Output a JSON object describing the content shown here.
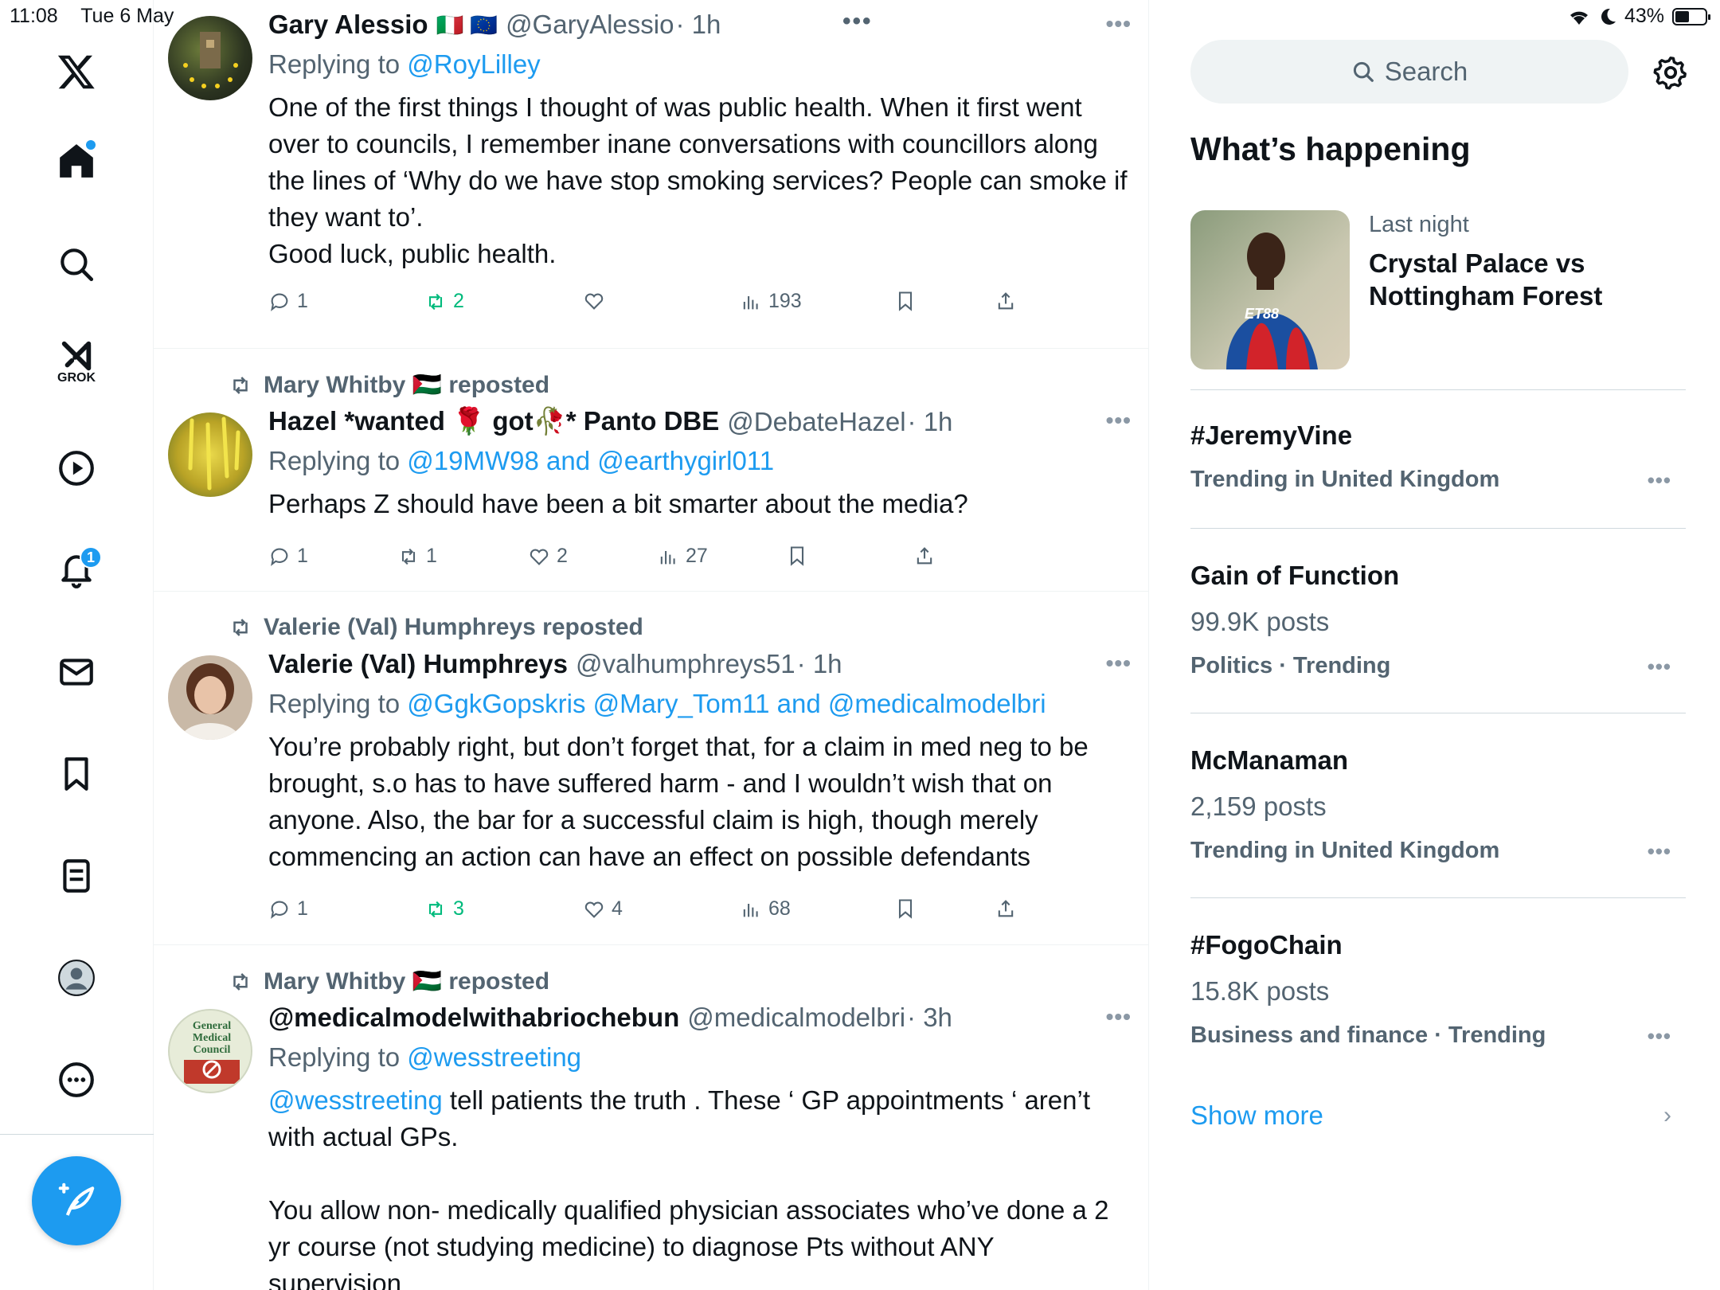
{
  "status": {
    "time": "11:08",
    "date": "Tue 6 May",
    "battery": "43%"
  },
  "nav": {
    "notifications_count": "1",
    "grok_label": "GROK"
  },
  "feed": {
    "tweets": [
      {
        "name": "Gary Alessio",
        "flags": "🇮🇹 🇪🇺",
        "handle": "@GaryAlessio",
        "time": "· 1h",
        "replying_prefix": "Replying to",
        "replying_to": "@RoyLilley",
        "body": [
          "One of the first things I thought of was public health. When it first went over to councils, I remember inane conversations with councillors along the lines of ‘Why do we have stop smoking services? People can smoke if they want to’.",
          "Good luck, public health."
        ],
        "replies": "1",
        "reposts": "2",
        "likes": "",
        "views": "193"
      },
      {
        "repost_by": "Mary Whitby 🇵🇸 reposted",
        "name": "Hazel *wanted 🌹 got🥀* Panto DBE",
        "handle": "@DebateHazel",
        "time": "· 1h",
        "replying_prefix": "Replying to",
        "replying_to": "@19MW98 and @earthygirl011",
        "body": [
          "Perhaps Z should have been a bit smarter about the media?"
        ],
        "replies": "1",
        "reposts": "1",
        "likes": "2",
        "views": "27"
      },
      {
        "repost_by": "Valerie (Val) Humphreys reposted",
        "name": "Valerie (Val) Humphreys",
        "handle": "@valhumphreys51",
        "time": "· 1h",
        "replying_prefix": "Replying to",
        "replying_to": "@GgkGopskris @Mary_Tom11 and @medicalmodelbri",
        "body": [
          "You’re probably right, but don’t forget that, for a claim in med neg to be brought, s.o has to have suffered harm - and I wouldn’t wish that on anyone. Also, the bar for a successful claim is high, though merely commencing an action can have an effect on possible defendants"
        ],
        "replies": "1",
        "reposts": "3",
        "likes": "4",
        "views": "68"
      },
      {
        "repost_by": "Mary Whitby 🇵🇸 reposted",
        "name": "@medicalmodelwithabriochebun",
        "handle": "@medicalmodelbri",
        "time": "· 3h",
        "replying_prefix": "Replying to",
        "replying_to": "@wesstreeting",
        "body_mention": "@wesstreeting",
        "body_first": " tell patients the truth . These ‘ GP appointments ‘ aren’t with actual GPs.",
        "body_rest": [
          "",
          "You allow non- medically qualified physician associates who’ve done a 2 yr course (not studying medicine) to diagnose Pts without ANY supervision"
        ],
        "avatar_text": "General Medical Council"
      }
    ]
  },
  "sidebar": {
    "search_placeholder": "Search",
    "heading": "What’s happening",
    "featured": {
      "sub": "Last night",
      "title": "Crystal Palace vs Nottingham Forest",
      "jersey_text": "ET88"
    },
    "trends": [
      {
        "title": "#JeremyVine",
        "posts": "",
        "meta": "Trending in United Kingdom"
      },
      {
        "title": "Gain of Function",
        "posts": "99.9K posts",
        "meta": "Politics · Trending"
      },
      {
        "title": "McManaman",
        "posts": "2,159 posts",
        "meta": "Trending in United Kingdom"
      },
      {
        "title": "#FogoChain",
        "posts": "15.8K posts",
        "meta": "Business and finance · Trending"
      }
    ],
    "show_more": "Show more"
  }
}
